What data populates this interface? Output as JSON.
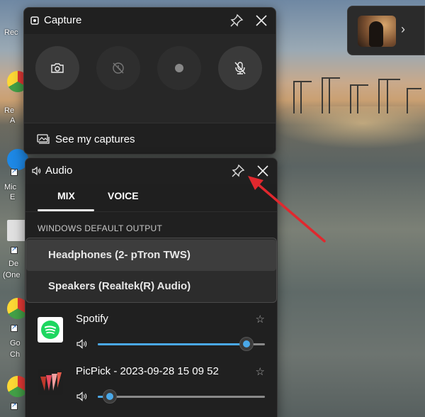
{
  "desktop": {
    "labels": [
      "Rec",
      "Re",
      "A",
      "Mic",
      "E",
      "De",
      "(One",
      "Go",
      "Ch"
    ]
  },
  "recent_capture": {
    "chevron": "›"
  },
  "capture": {
    "title": "Capture",
    "buttons": [
      {
        "name": "screenshot-button",
        "icon": "camera-icon",
        "enabled": true
      },
      {
        "name": "record-last-button",
        "icon": "history-disabled-icon",
        "enabled": false
      },
      {
        "name": "start-recording-button",
        "icon": "record-dot-icon",
        "enabled": false
      },
      {
        "name": "microphone-button",
        "icon": "mic-off-icon",
        "enabled": true
      }
    ],
    "see_captures_label": "See my captures"
  },
  "audio": {
    "title": "Audio",
    "tabs": [
      {
        "label": "MIX",
        "active": true
      },
      {
        "label": "VOICE",
        "active": false
      }
    ],
    "section_label": "WINDOWS DEFAULT OUTPUT",
    "outputs": [
      {
        "label": "Headphones (2- pTron TWS)",
        "selected": true
      },
      {
        "label": "Speakers (Realtek(R) Audio)",
        "selected": false
      }
    ],
    "apps": [
      {
        "name": "Spotify",
        "volume": 0.89,
        "logo": "spotify-logo"
      },
      {
        "name": "PicPick - 2023-09-28 15 09 52",
        "volume": 0.07,
        "logo": "picpick-logo"
      }
    ]
  },
  "colors": {
    "panel_bg": "#202020",
    "accent": "#4aa8e8",
    "annotation_arrow": "#e0282e"
  }
}
